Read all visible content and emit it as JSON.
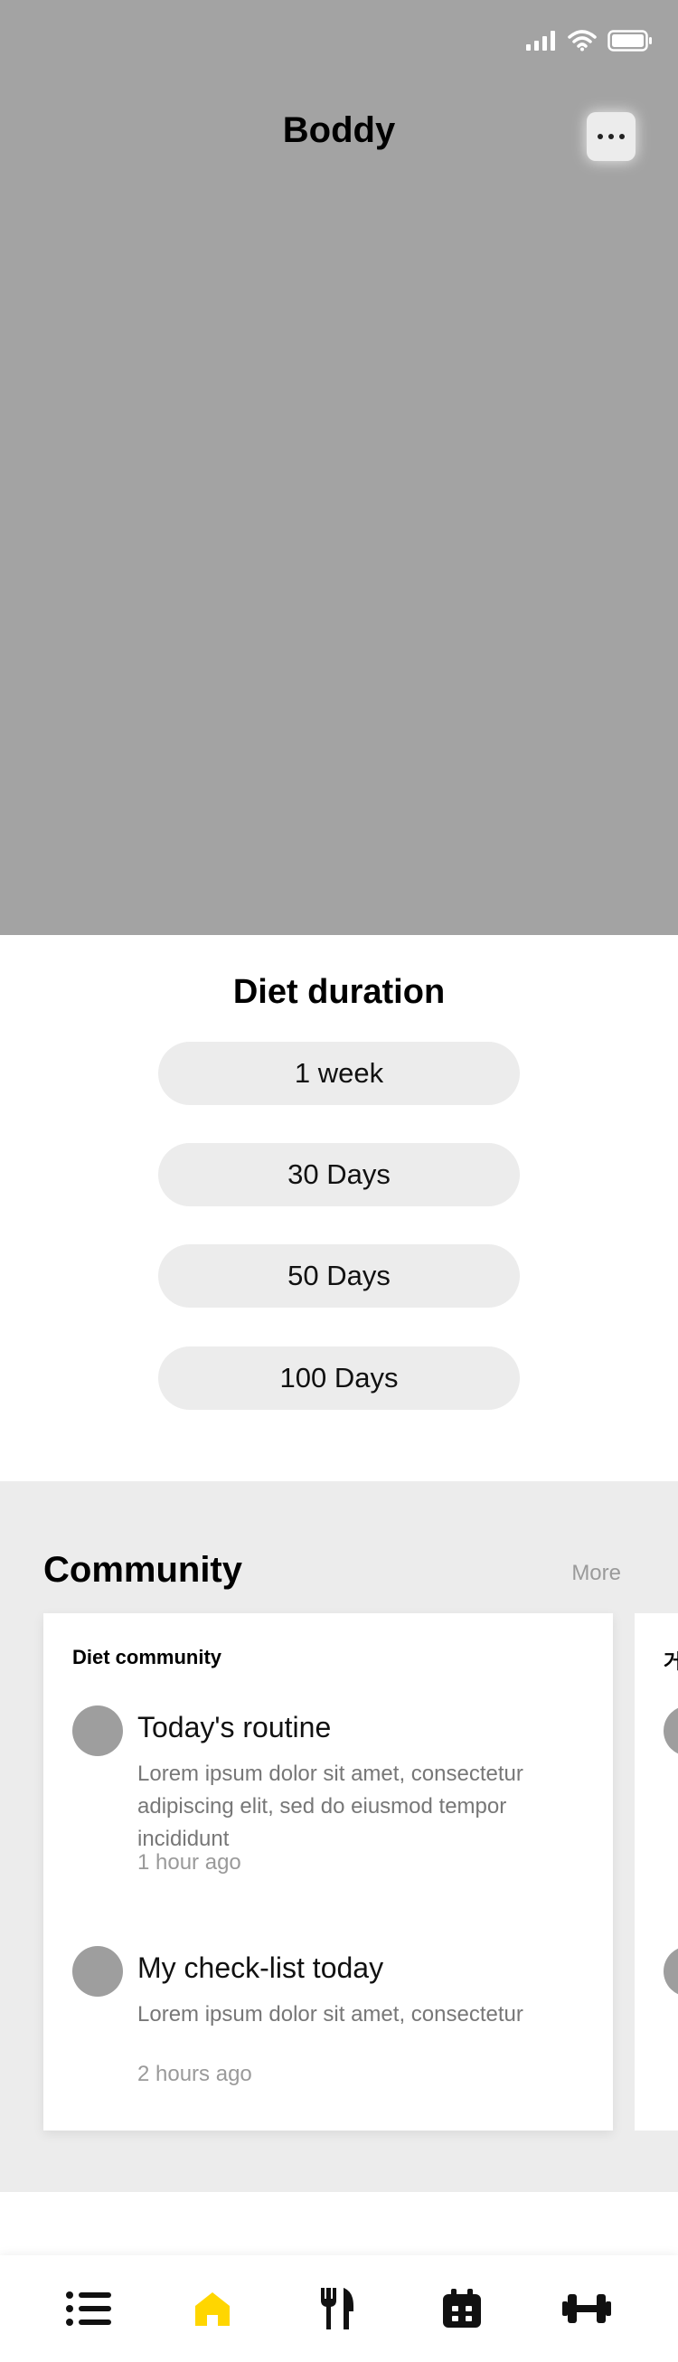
{
  "app": {
    "title": "Boddy"
  },
  "status": {
    "icons": [
      "signal-icon",
      "wifi-icon",
      "battery-icon"
    ]
  },
  "header": {
    "more_icon": "more-dots-icon"
  },
  "diet": {
    "title": "Diet duration",
    "options": [
      "1 week",
      "30 Days",
      "50 Days",
      "100 Days"
    ]
  },
  "community": {
    "title": "Community",
    "more_label": "More",
    "cards": [
      {
        "category": "Diet community",
        "posts": [
          {
            "title": "Today's routine",
            "body": "Lorem ipsum dolor sit amet, consectetur adipiscing elit, sed do eiusmod tempor incididunt",
            "time": "1 hour ago"
          },
          {
            "title": "My check-list today",
            "body": "Lorem ipsum dolor sit amet, consectetur",
            "time": "2 hours ago"
          }
        ]
      },
      {
        "category": "거"
      }
    ]
  },
  "tabbar": {
    "items": [
      {
        "icon": "list-icon",
        "active": false
      },
      {
        "icon": "home-icon",
        "active": true
      },
      {
        "icon": "fork-knife-icon",
        "active": false
      },
      {
        "icon": "calendar-icon",
        "active": false
      },
      {
        "icon": "dumbbell-icon",
        "active": false
      }
    ],
    "active_color": "#FFD600"
  }
}
